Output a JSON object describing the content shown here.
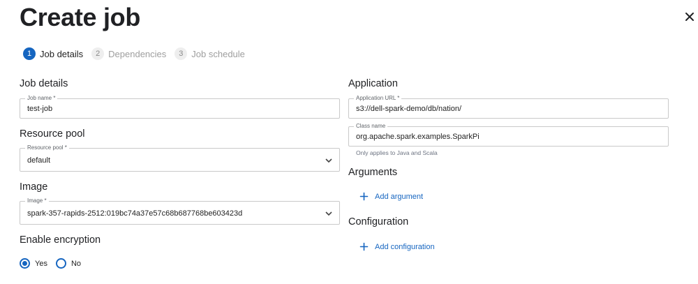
{
  "header": {
    "title": "Create job",
    "close_icon": "close-icon"
  },
  "stepper": {
    "steps": [
      {
        "number": "1",
        "label": "Job details",
        "active": true
      },
      {
        "number": "2",
        "label": "Dependencies",
        "active": false
      },
      {
        "number": "3",
        "label": "Job schedule",
        "active": false
      }
    ]
  },
  "left": {
    "job_details_title": "Job details",
    "job_name": {
      "label": "Job name *",
      "value": "test-job"
    },
    "resource_pool_title": "Resource pool",
    "resource_pool": {
      "label": "Resource pool *",
      "value": "default"
    },
    "image_title": "Image",
    "image": {
      "label": "Image *",
      "value": "spark-357-rapids-2512:019bc74a37e57c68b687768be603423d"
    },
    "encryption_title": "Enable encryption",
    "encryption_options": [
      {
        "label": "Yes",
        "checked": true
      },
      {
        "label": "No",
        "checked": false
      }
    ]
  },
  "right": {
    "application_title": "Application",
    "application_url": {
      "label": "Application URL *",
      "value": "s3://dell-spark-demo/db/nation/"
    },
    "class_name": {
      "label": "Class name",
      "value": "org.apache.spark.examples.SparkPi",
      "helper": "Only applies to Java and Scala"
    },
    "arguments_title": "Arguments",
    "add_argument_label": "Add argument",
    "configuration_title": "Configuration",
    "add_configuration_label": "Add configuration"
  },
  "colors": {
    "accent": "#1565c0",
    "border": "#c9c9c9",
    "muted_text": "#9e9e9e"
  }
}
